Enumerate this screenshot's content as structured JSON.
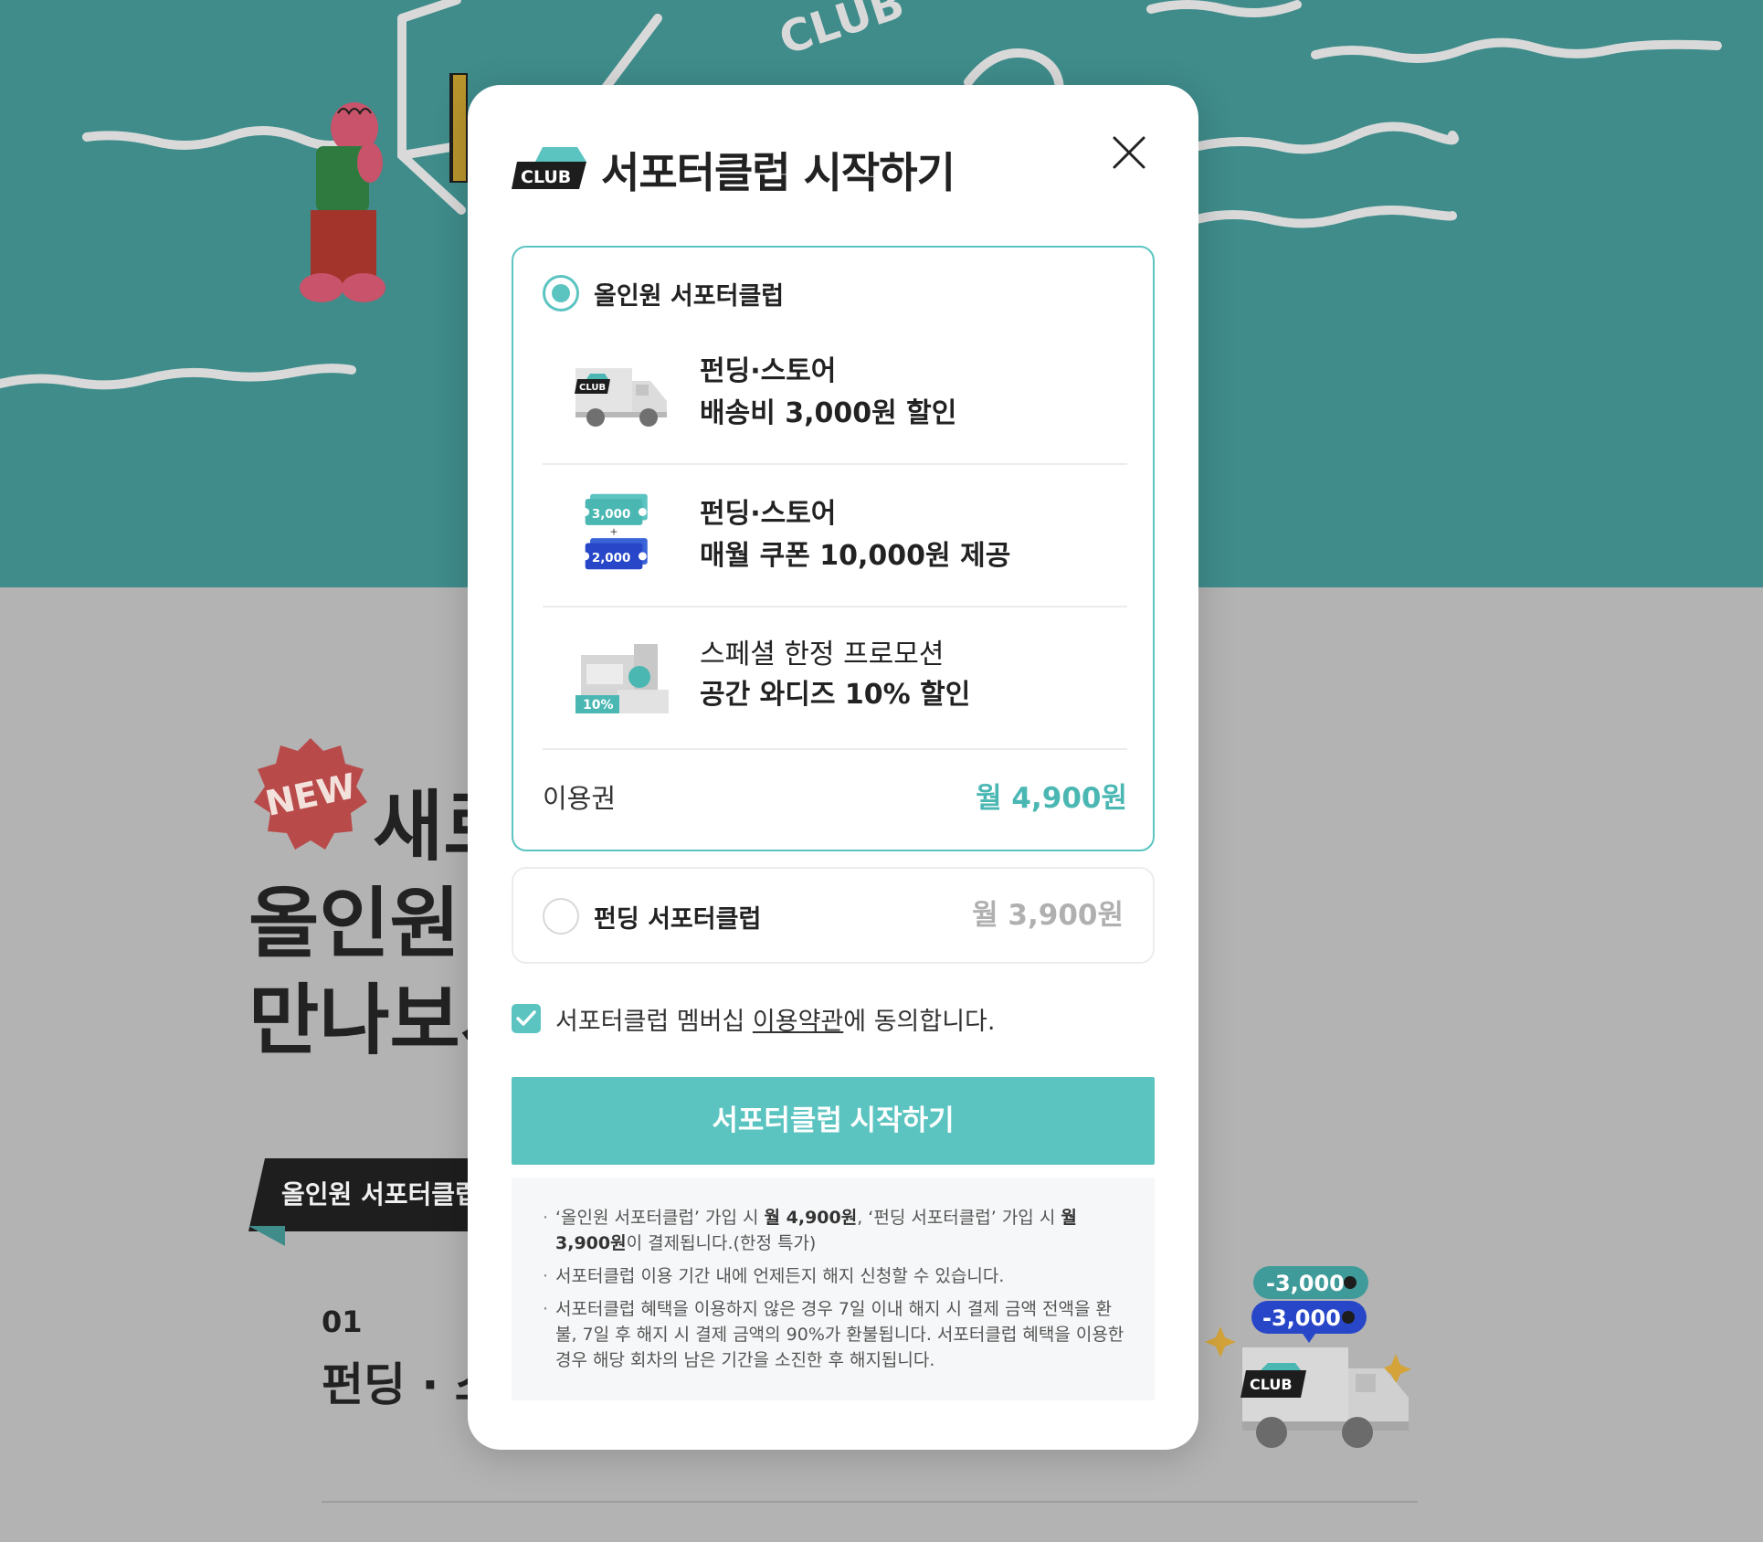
{
  "background": {
    "hero_text": "CLUB",
    "new_badge": "NEW",
    "headline": {
      "line1": "새로",
      "line2": "올인원",
      "line3": "만나보시"
    },
    "ribbon_label": "올인원 서포터클럽",
    "section_number": "01",
    "section_title": "펀딩 · 스",
    "deco_coupon_1": "-3,000",
    "deco_coupon_2": "-3,000",
    "deco_truck_label": "CLUB"
  },
  "modal": {
    "logo_text": "CLUB",
    "title": "서포터클럽 시작하기",
    "plans": [
      {
        "name": "올인원 서포터클럽",
        "selected": true,
        "benefits": [
          {
            "icon": "delivery-truck-icon",
            "line1": "펀딩·스토어",
            "line2": "배송비 3,000원 할인",
            "icon_label": "CLUB"
          },
          {
            "icon": "coupon-icon",
            "line1": "펀딩·스토어",
            "line2": "매월 쿠폰 10,000원 제공",
            "coupon_a": "3,000",
            "coupon_b": "2,000"
          },
          {
            "icon": "space-wadiz-icon",
            "line1": "스페셜 한정 프로모션",
            "line2": "공간 와디즈 10% 할인",
            "icon_label": "10%"
          }
        ],
        "price_label": "이용권",
        "price": "월 4,900원"
      },
      {
        "name": "펀딩 서포터클럽",
        "selected": false,
        "price": "월 3,900원"
      }
    ],
    "agreement": {
      "checked": true,
      "prefix": "서포터클럽 멤버십 ",
      "link": "이용약관",
      "suffix": "에 동의합니다."
    },
    "cta_label": "서포터클럽 시작하기",
    "notices": {
      "n1_a": "‘올인원 서포터클럽’ 가입 시 ",
      "n1_b": "월 4,900원",
      "n1_c": ", ‘펀딩 서포터클럽’ 가입 시 ",
      "n1_d": "월 3,900원",
      "n1_e": "이 결제됩니다.(한정 특가)",
      "n2": "서포터클럽 이용 기간 내에 언제든지 해지 신청할 수 있습니다.",
      "n3": "서포터클럽 혜택을 이용하지 않은 경우 7일 이내 해지 시 결제 금액 전액을 환불, 7일 후 해지 시 결제 금액의 90%가 환불됩니다. 서포터클럽 혜택을 이용한 경우 해당 회차의 남은 기간을 소진한 후 해지됩니다."
    }
  },
  "colors": {
    "accent": "#5bc4c1",
    "price_accent": "#4ab7b3",
    "hero_bg": "#3f8c8b",
    "overlay_bg": "#b3b3b3"
  }
}
